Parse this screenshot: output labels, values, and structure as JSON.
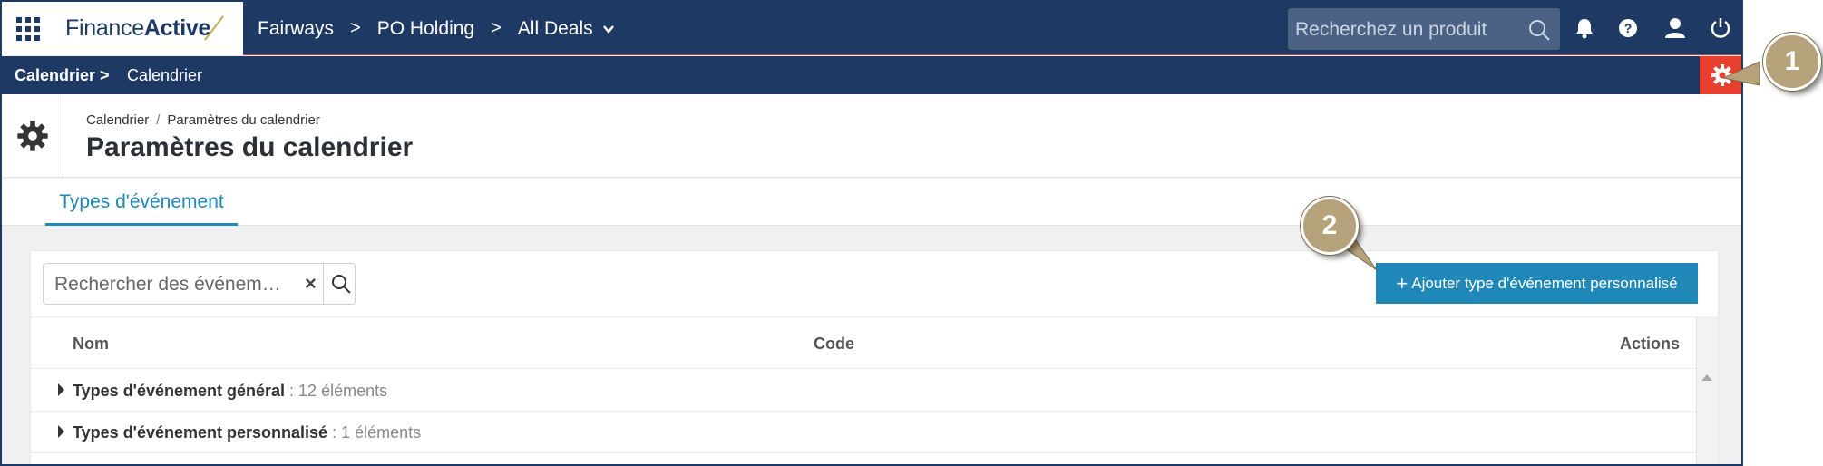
{
  "topbar": {
    "logo_part1": "Finance",
    "logo_part2": "Active",
    "crumbs": [
      "Fairways",
      "PO Holding",
      "All Deals"
    ],
    "search_placeholder": "Recherchez un produit",
    "icons": [
      "bell-icon",
      "help-icon",
      "user-icon",
      "power-icon"
    ],
    "brand_color": "#1e3a64"
  },
  "subbar": {
    "crumb_1": "Calendrier",
    "crumb_2": "Calendrier",
    "settings_color": "#e8402e"
  },
  "header": {
    "breadcrumb_1": "Calendrier",
    "breadcrumb_sep": "/",
    "breadcrumb_2": "Paramètres du calendrier",
    "title": "Paramètres du calendrier"
  },
  "tabs": [
    {
      "label": "Types d'événement",
      "active": true
    }
  ],
  "panel": {
    "search_placeholder": "Rechercher des événem…",
    "clear_label": "×",
    "add_button_label": "Ajouter type d'événement personnalisé",
    "accent_color": "#1f88b8",
    "columns": {
      "nom": "Nom",
      "code": "Code",
      "actions": "Actions"
    },
    "rows": [
      {
        "label": "Types d'événement général",
        "count": " : 12 éléments"
      },
      {
        "label": "Types d'événement personnalisé",
        "count": " : 1 éléments"
      }
    ]
  },
  "callouts": [
    "1",
    "2"
  ]
}
